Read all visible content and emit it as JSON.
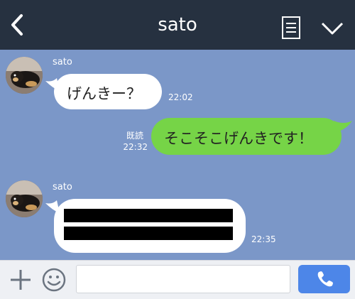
{
  "header": {
    "title": "sato",
    "back_icon": "chevron-left-icon",
    "notes_icon": "notes-icon",
    "menu_icon": "chevron-down-icon"
  },
  "messages": [
    {
      "direction": "incoming",
      "sender": "sato",
      "text": "げんきー？",
      "time": "22:02"
    },
    {
      "direction": "outgoing",
      "text": "そこそこげんきです！",
      "read_label": "既読",
      "time": "22:32"
    },
    {
      "direction": "incoming",
      "sender": "sato",
      "text": "[redacted]",
      "time": "22:35"
    }
  ],
  "input": {
    "value": "",
    "placeholder": ""
  },
  "footer": {
    "plus_icon": "plus-icon",
    "emoji_icon": "emoji-icon",
    "call_icon": "phone-icon"
  },
  "colors": {
    "header_bg": "#263140",
    "chat_bg": "#7b97c8",
    "outgoing_bubble": "#76d447",
    "incoming_bubble": "#ffffff",
    "call_button": "#4d86e8"
  }
}
